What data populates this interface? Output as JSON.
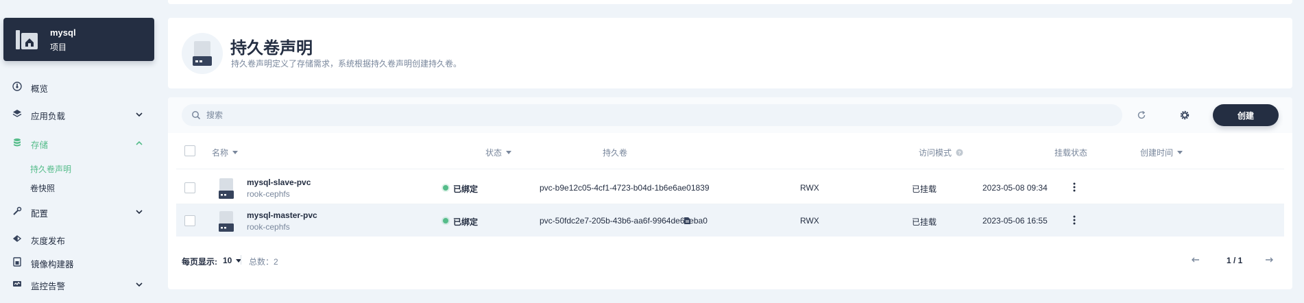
{
  "project": {
    "name": "mysql",
    "type": "项目"
  },
  "sidebar": {
    "items": [
      {
        "label": "概览",
        "icon": "dashboard-icon"
      },
      {
        "label": "应用负载",
        "icon": "layers-icon",
        "expandable": true
      },
      {
        "label": "存储",
        "icon": "database-icon",
        "expandable": true,
        "expanded": true,
        "active": true
      },
      {
        "label": "配置",
        "icon": "wrench-icon",
        "expandable": true
      },
      {
        "label": "灰度发布",
        "icon": "grayscale-release-icon"
      },
      {
        "label": "镜像构建器",
        "icon": "image-builder-icon"
      },
      {
        "label": "监控告警",
        "icon": "monitoring-icon",
        "expandable": true
      }
    ],
    "subitems": [
      {
        "label": "持久卷声明",
        "active": true
      },
      {
        "label": "卷快照",
        "active": false
      }
    ]
  },
  "header": {
    "title": "持久卷声明",
    "description": "持久卷声明定义了存储需求，系统根据持久卷声明创建持久卷。"
  },
  "toolbar": {
    "search_placeholder": "搜索",
    "create_label": "创建"
  },
  "table": {
    "columns": {
      "name": "名称",
      "status": "状态",
      "volume": "持久卷",
      "access_mode": "访问模式",
      "mount_status": "挂载状态",
      "created_at": "创建时间"
    },
    "rows": [
      {
        "name": "mysql-slave-pvc",
        "storage_class": "rook-cephfs",
        "status": "已绑定",
        "volume": "pvc-b9e12c05-4cf1-4723-b04d-1b6e6ae01839",
        "access_mode": "RWX",
        "mount_status": "已挂载",
        "created_at": "2023-05-08 09:34"
      },
      {
        "name": "mysql-master-pvc",
        "storage_class": "rook-cephfs",
        "status": "已绑定",
        "volume": "pvc-50fdc2e7-205b-43b6-aa6f-9964de6eeba0",
        "access_mode": "RWX",
        "mount_status": "已挂载",
        "created_at": "2023-05-06 16:55"
      }
    ]
  },
  "footer": {
    "page_size_label": "每页显示:",
    "page_size": "10",
    "total": "总数：2",
    "pager": "1 / 1"
  },
  "colors": {
    "brand_dark": "#242e42",
    "accent_green": "#55bc8a",
    "muted": "#79879c",
    "background": "#eff4f9"
  }
}
